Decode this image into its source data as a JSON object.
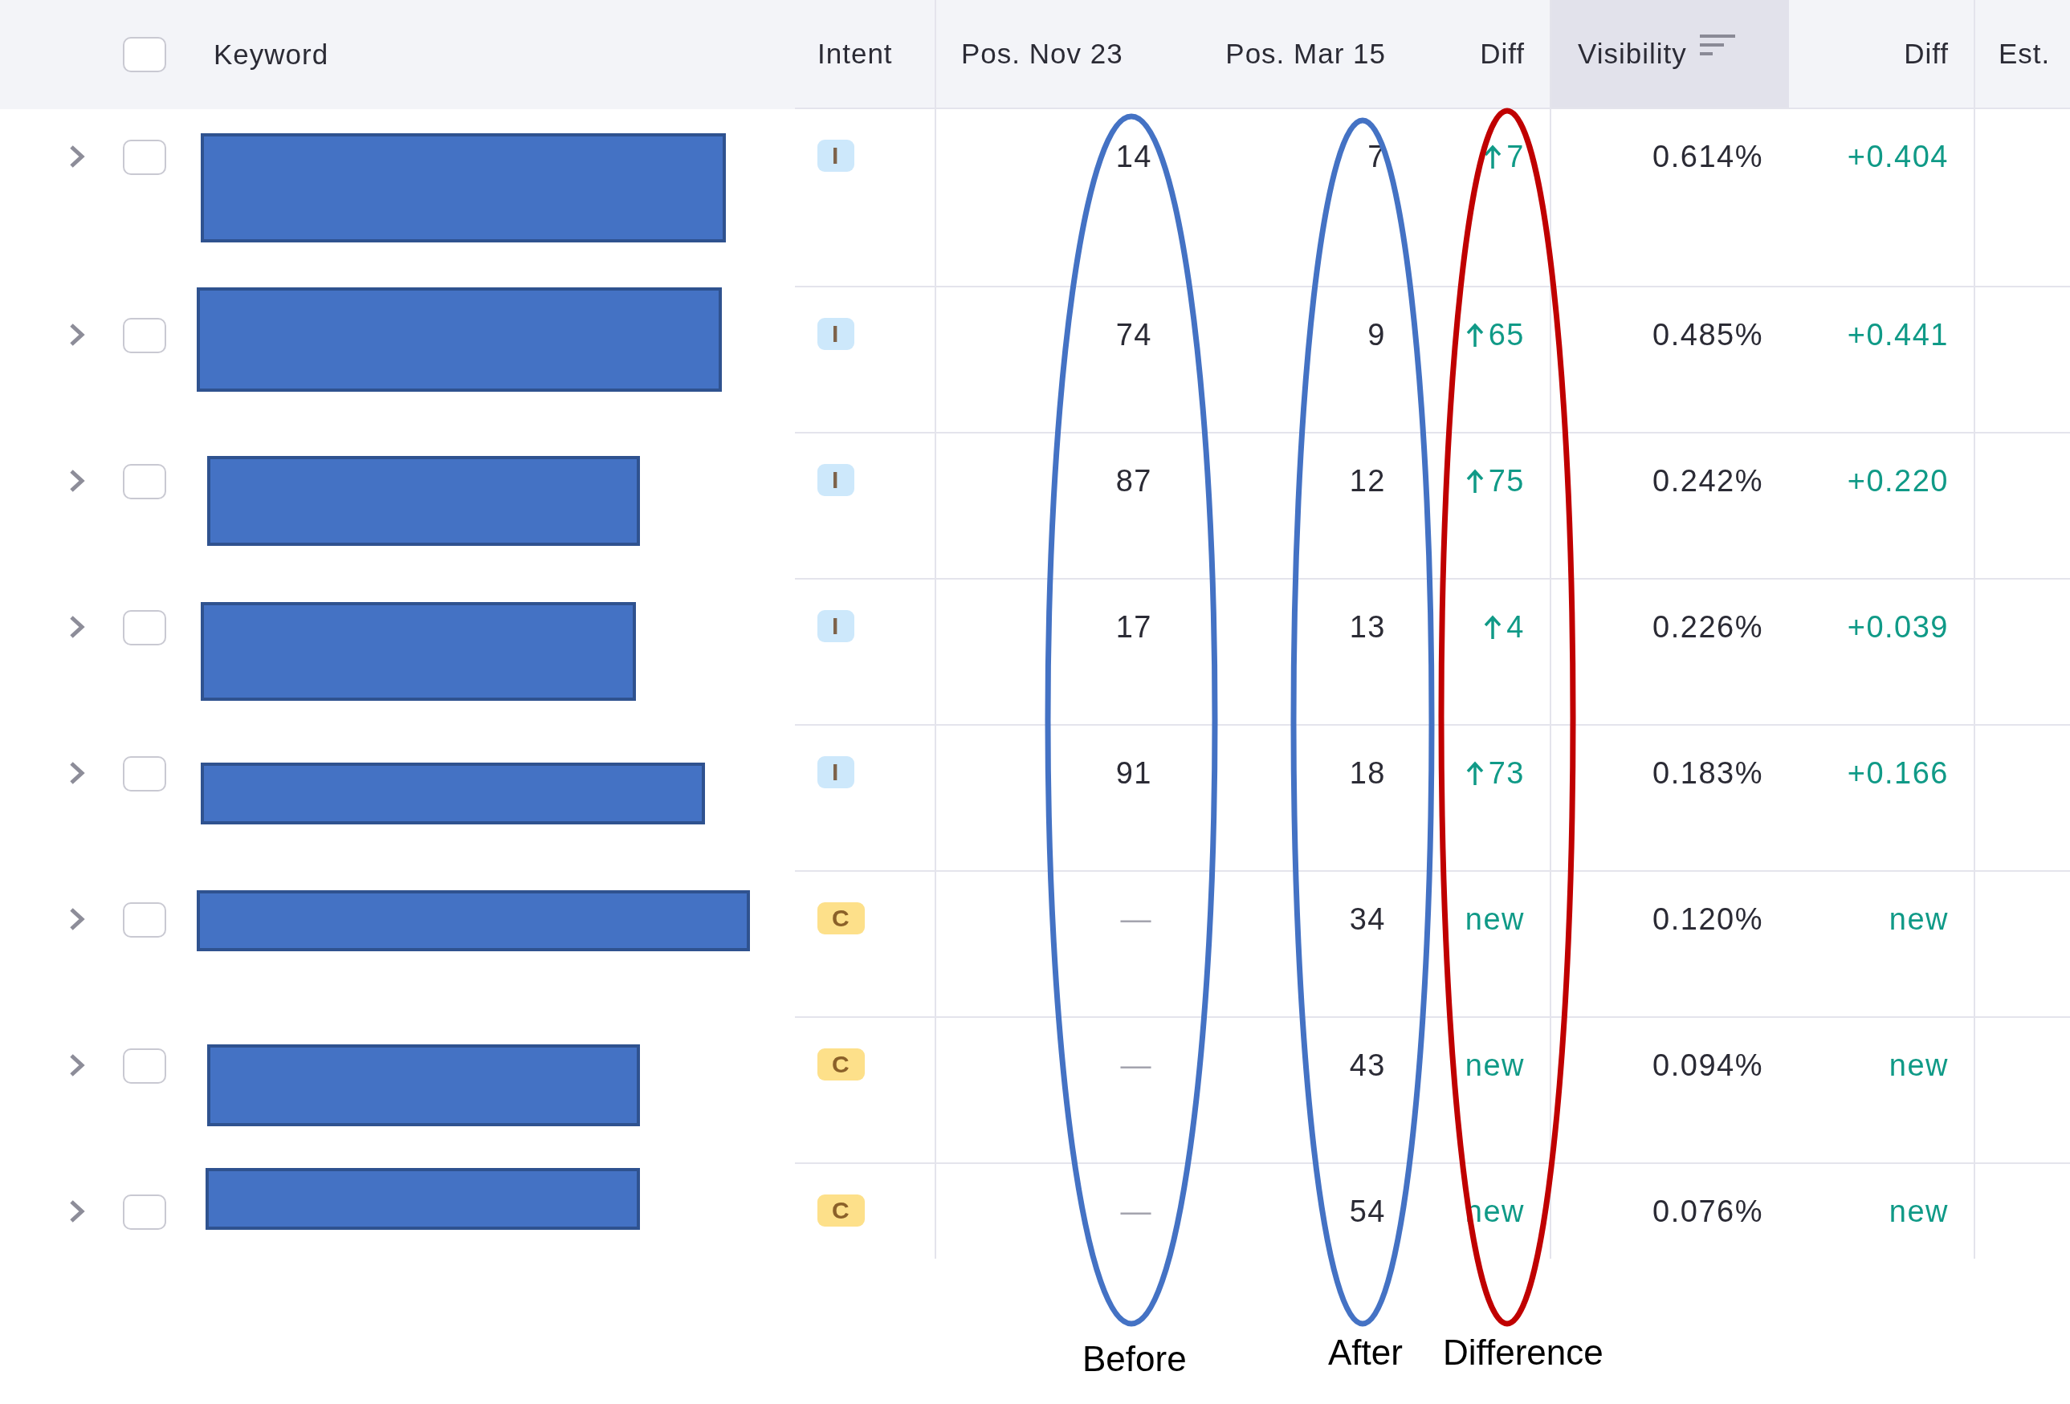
{
  "table": {
    "header_checkbox": {
      "checked": false
    },
    "columns": [
      {
        "label": "Keyword",
        "sorted": false
      },
      {
        "label": "Intent",
        "sorted": false
      },
      {
        "label": "Pos. Nov 23",
        "sorted": false
      },
      {
        "label": "Pos. Mar 15",
        "sorted": false
      },
      {
        "label": "Diff",
        "sorted": false
      },
      {
        "label": "Visibility",
        "sorted": true
      },
      {
        "label": "Diff",
        "sorted": false
      },
      {
        "label": "Est.",
        "sorted": false
      }
    ],
    "rows": [
      {
        "expanded": false,
        "checked": false,
        "intent": {
          "label": "I",
          "color": "#cde8fb"
        },
        "pos_before": "14",
        "pos_after": "7",
        "diff": {
          "kind": "up",
          "value": "7"
        },
        "visibility": "0.614%",
        "visibility_diff": "+0.404"
      },
      {
        "expanded": false,
        "checked": false,
        "intent": {
          "label": "I",
          "color": "#cde8fb"
        },
        "pos_before": "74",
        "pos_after": "9",
        "diff": {
          "kind": "up",
          "value": "65"
        },
        "visibility": "0.485%",
        "visibility_diff": "+0.441"
      },
      {
        "expanded": false,
        "checked": false,
        "intent": {
          "label": "I",
          "color": "#cde8fb"
        },
        "pos_before": "87",
        "pos_after": "12",
        "diff": {
          "kind": "up",
          "value": "75"
        },
        "visibility": "0.242%",
        "visibility_diff": "+0.220"
      },
      {
        "expanded": false,
        "checked": false,
        "intent": {
          "label": "I",
          "color": "#cde8fb"
        },
        "pos_before": "17",
        "pos_after": "13",
        "diff": {
          "kind": "up",
          "value": "4"
        },
        "visibility": "0.226%",
        "visibility_diff": "+0.039"
      },
      {
        "expanded": false,
        "checked": false,
        "intent": {
          "label": "I",
          "color": "#cde8fb"
        },
        "pos_before": "91",
        "pos_after": "18",
        "diff": {
          "kind": "up",
          "value": "73"
        },
        "visibility": "0.183%",
        "visibility_diff": "+0.166"
      },
      {
        "expanded": false,
        "checked": false,
        "intent": {
          "label": "C",
          "color": "#fde08a"
        },
        "pos_before": "—",
        "pos_after": "34",
        "diff": {
          "kind": "new",
          "value": "new"
        },
        "visibility": "0.120%",
        "visibility_diff": "new"
      },
      {
        "expanded": false,
        "checked": false,
        "intent": {
          "label": "C",
          "color": "#fde08a"
        },
        "pos_before": "—",
        "pos_after": "43",
        "diff": {
          "kind": "new",
          "value": "new"
        },
        "visibility": "0.094%",
        "visibility_diff": "new"
      },
      {
        "expanded": false,
        "checked": false,
        "intent": {
          "label": "C",
          "color": "#fde08a"
        },
        "pos_before": "—",
        "pos_after": "54",
        "diff": {
          "kind": "new",
          "value": "new"
        },
        "visibility": "0.076%",
        "visibility_diff": "new"
      }
    ]
  },
  "annotations": [
    {
      "label": "Before",
      "color": "#4472c4"
    },
    {
      "label": "After",
      "color": "#4472c4"
    },
    {
      "label": "Difference",
      "color": "#c00000"
    }
  ]
}
